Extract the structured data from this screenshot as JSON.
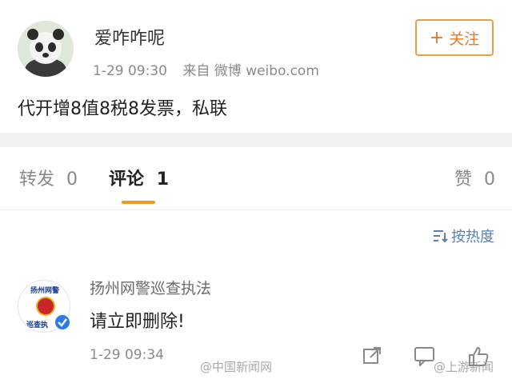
{
  "post": {
    "username": "爱咋咋呢",
    "timestamp": "1-29 09:30",
    "source": "来自 微博 weibo.com",
    "content": "代开增8值8税8发票，私联",
    "follow_label": "关注",
    "follow_icon": "plus-icon"
  },
  "tabs": [
    {
      "label": "转发",
      "count": "0"
    },
    {
      "label": "评论",
      "count": "1"
    },
    {
      "label": "赞",
      "count": "0"
    }
  ],
  "sort_label": "按热度",
  "comment": {
    "username": "扬州网警巡查执法",
    "avatar_text_top": "扬州网警",
    "avatar_text_bottom": "巡查执",
    "text": "请立即删除!",
    "timestamp": "1-29 09:34"
  },
  "watermarks": [
    "@中国新闻网",
    "@上游新闻"
  ],
  "colors": {
    "accent": "#f29b16",
    "link": "#5b7fb0",
    "verified": "#2e7ae6"
  }
}
